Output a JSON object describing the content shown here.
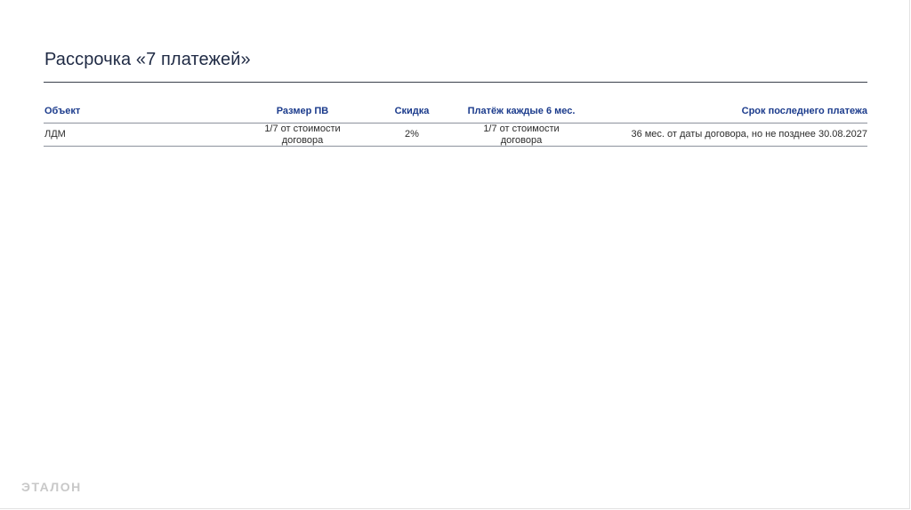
{
  "title": "Рассрочка «7 платежей»",
  "table": {
    "headers": {
      "object": "Объект",
      "size": "Размер ПВ",
      "discount": "Скидка",
      "payment": "Платёж каждые 6 мес.",
      "term": "Срок последнего платежа"
    },
    "rows": [
      {
        "object": "ЛДМ",
        "size": "1/7 от стоимости договора",
        "discount": "2%",
        "payment": "1/7 от стоимости договора",
        "term": "36 мес. от даты договора, но не позднее 30.08.2027"
      }
    ]
  },
  "logo": "ЭТАЛОН"
}
